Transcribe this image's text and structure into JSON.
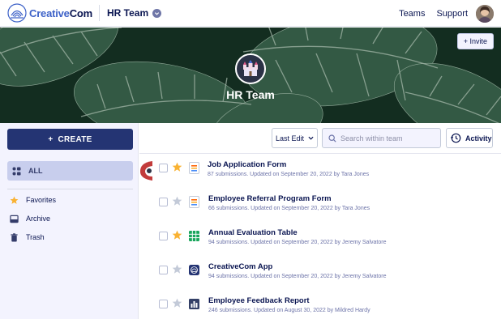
{
  "topbar": {
    "logo_text": "CreativeCom",
    "logo_accent": "Creative",
    "logo_rest": "Com",
    "team_select_label": "HR Team",
    "nav_links": [
      "Teams",
      "Support"
    ]
  },
  "banner": {
    "invite_label": "+ Invite",
    "team_title": "HR Team",
    "team_icon": "castle-icon"
  },
  "sidebar": {
    "create_label": "CREATE",
    "create_plus": "+",
    "all_label": "ALL",
    "items": [
      {
        "label": "Favorites",
        "icon": "star-icon"
      },
      {
        "label": "Archive",
        "icon": "archive-icon"
      },
      {
        "label": "Trash",
        "icon": "trash-icon"
      }
    ]
  },
  "toolbar": {
    "sort_label": "Last Edit",
    "search_placeholder": "Search within team",
    "activity_label": "Activity"
  },
  "forms": [
    {
      "title": "Job Application Form",
      "meta": "87 submissions. Updated on September 20, 2022 by Tara Jones",
      "favorite": true,
      "icon": "form-icon"
    },
    {
      "title": "Employee Referral Program Form",
      "meta": "66 submissions. Updated on September 20, 2022 by Tara Jones",
      "favorite": false,
      "icon": "form-icon"
    },
    {
      "title": "Annual Evaluation Table",
      "meta": "94 submissions. Updated on September 20, 2022 by Jeremy Salvatore",
      "favorite": true,
      "icon": "table-icon"
    },
    {
      "title": "CreativeCom App",
      "meta": "94 submissions. Updated on September 20, 2022 by Jeremy Salvatore",
      "favorite": false,
      "icon": "app-icon"
    },
    {
      "title": "Employee Feedback Report",
      "meta": "246 submissions. Updated on August 30, 2022 by Mildred Hardy",
      "favorite": false,
      "icon": "report-icon"
    }
  ],
  "colors": {
    "primary": "#243473",
    "star_on": "#f9b233",
    "star_off": "#c3cad8",
    "selected_bg": "#c8ceed"
  }
}
